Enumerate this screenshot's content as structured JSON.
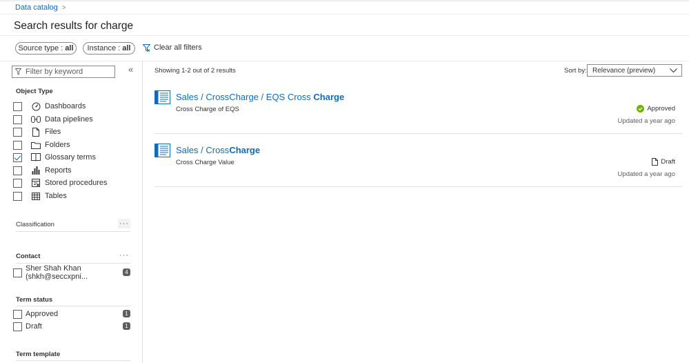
{
  "breadcrumb": {
    "root": "Data catalog",
    "separator": ">"
  },
  "page": {
    "title": "Search results for charge"
  },
  "filters_bar": {
    "source_type_label": "Source type :",
    "source_type_value": "all",
    "instance_label": "Instance :",
    "instance_value": "all",
    "clear_all": "Clear all filters"
  },
  "sidebar": {
    "keyword_placeholder": "Filter by keyword",
    "collapse_glyph": "«",
    "object_type": {
      "title": "Object Type",
      "items": [
        {
          "label": "Dashboards",
          "icon": "dashboard-icon",
          "checked": false
        },
        {
          "label": "Data pipelines",
          "icon": "pipeline-icon",
          "checked": false
        },
        {
          "label": "Files",
          "icon": "file-icon",
          "checked": false
        },
        {
          "label": "Folders",
          "icon": "folder-icon",
          "checked": false
        },
        {
          "label": "Glossary terms",
          "icon": "glossary-icon",
          "checked": true
        },
        {
          "label": "Reports",
          "icon": "bar-chart-icon",
          "checked": false
        },
        {
          "label": "Stored procedures",
          "icon": "stored-procedure-icon",
          "checked": false
        },
        {
          "label": "Tables",
          "icon": "table-icon",
          "checked": false
        }
      ]
    },
    "classification": {
      "title": "Classification",
      "more": "···"
    },
    "contact": {
      "title": "Contact",
      "more": "···",
      "items": [
        {
          "label": "Sher Shah Khan (shkh@seccxpni...",
          "count": "4"
        }
      ]
    },
    "term_status": {
      "title": "Term status",
      "items": [
        {
          "label": "Approved",
          "count": "1"
        },
        {
          "label": "Draft",
          "count": "1"
        }
      ]
    },
    "term_template": {
      "title": "Term template"
    }
  },
  "results": {
    "summary": "Showing 1-2 out of 2 results",
    "sort_label": "Sort by:",
    "sort_value": "Relevance (preview)",
    "items": [
      {
        "title_prefix": "Sales / CrossCharge / EQS Cross ",
        "title_highlight": "Charge",
        "description": "Cross Charge of EQS",
        "status": "Approved",
        "updated": "Updated a year ago"
      },
      {
        "title_prefix": "Sales / Cross",
        "title_highlight": "Charge",
        "description": "Cross Charge Value",
        "status": "Draft",
        "updated": "Updated a year ago"
      }
    ]
  },
  "colors": {
    "accent": "#0f6cbd",
    "approved": "#6bb700",
    "text": "#323130"
  }
}
